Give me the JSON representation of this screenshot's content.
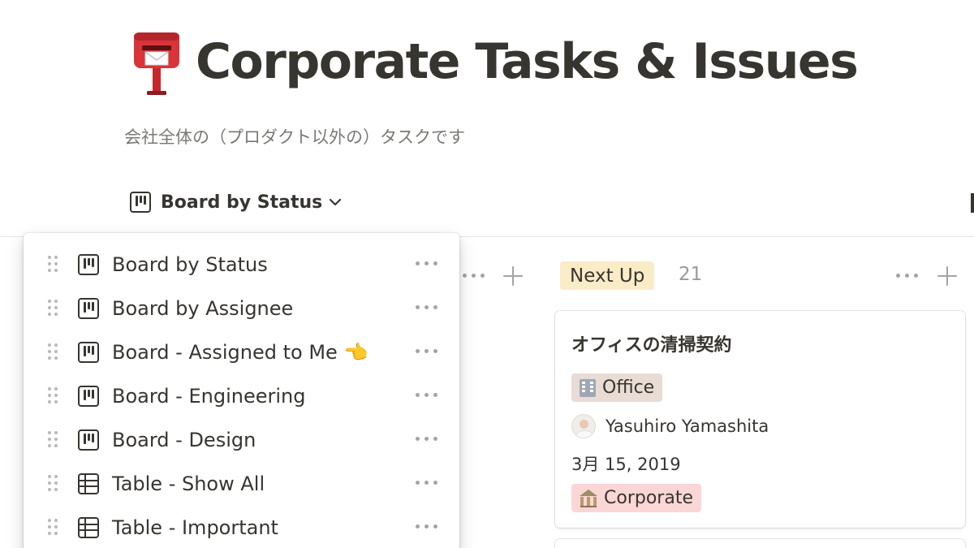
{
  "page": {
    "icon": "postbox-icon",
    "title": "Corporate Tasks & Issues",
    "subtitle": "会社全体の（プロダクト以外の）タスクです"
  },
  "view_switcher": {
    "current": "Board by Status",
    "icon": "board-icon"
  },
  "views_menu": {
    "items": [
      {
        "label": "Board by Status",
        "icon": "board-icon"
      },
      {
        "label": "Board by Assignee",
        "icon": "board-icon"
      },
      {
        "label": "Board - Assigned to Me 👈",
        "icon": "board-icon"
      },
      {
        "label": "Board - Engineering",
        "icon": "board-icon"
      },
      {
        "label": "Board - Design",
        "icon": "board-icon"
      },
      {
        "label": "Table - Show All",
        "icon": "table-icon"
      },
      {
        "label": "Table - Important",
        "icon": "table-icon"
      }
    ]
  },
  "board": {
    "groups": [
      {
        "label": "Next Up",
        "count": "21",
        "color": "#fbecc8",
        "cards": [
          {
            "title": "オフィスの清掃契約",
            "category": {
              "label": "Office",
              "icon": "office-building-icon",
              "color": "#e8dcd4"
            },
            "assignee": "Yasuhiro Yamashita",
            "date": "3月 15, 2019",
            "department": {
              "label": "Corporate",
              "icon": "bank-icon",
              "color": "#fbd6d6"
            }
          }
        ]
      }
    ]
  },
  "colors": {
    "text": "#37352f",
    "muted": "#9b9a97",
    "divider": "#e6e5e3"
  }
}
